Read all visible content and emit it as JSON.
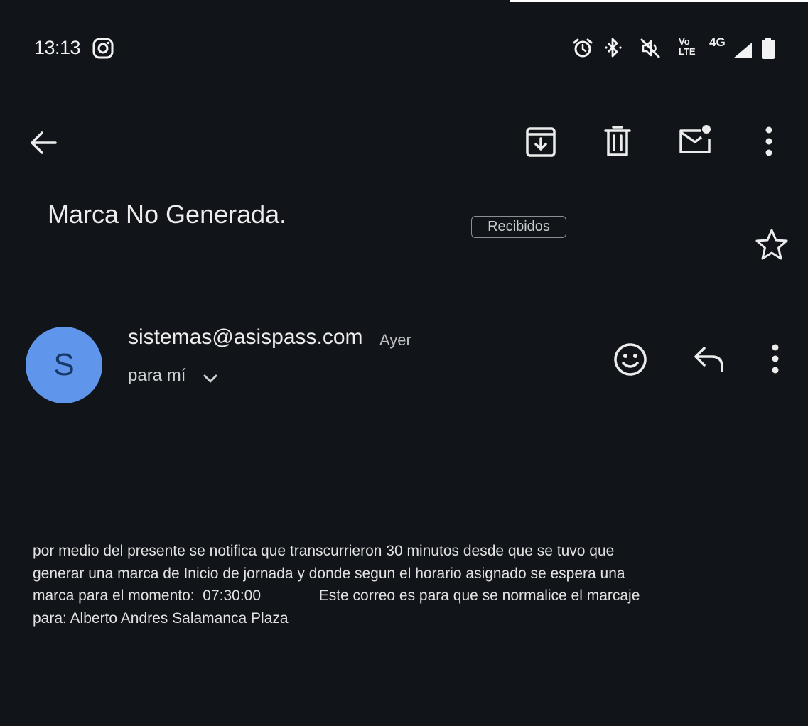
{
  "status_bar": {
    "time": "13:13",
    "network": "4G",
    "volte_top": "Vo",
    "volte_bottom": "LTE",
    "icons": [
      "instagram-icon",
      "alarm-icon",
      "bluetooth-icon",
      "mute-icon",
      "volte-icon",
      "signal-icon",
      "battery-icon"
    ]
  },
  "toolbar": {
    "icons": [
      "back-arrow-icon",
      "archive-icon",
      "delete-icon",
      "mark-unread-icon",
      "more-vert-icon"
    ]
  },
  "email": {
    "subject": "Marca No Generada.",
    "label": "Recibidos",
    "sender": {
      "initial": "S",
      "address": "sistemas@asispass.com",
      "date": "Ayer",
      "recipient": "para mí",
      "avatar_color": "#5f95eb"
    },
    "body_lines": [
      "por medio del presente se notifica que transcurrieron 30 minutos desde que se tuvo que",
      "generar una marca de Inicio de jornada y donde segun el horario asignado se espera una",
      "marca para el momento:  07:30:00              Este correo es para que se normalice el marcaje",
      "para: Alberto Andres Salamanca Plaza"
    ]
  },
  "colors": {
    "background": "#111418",
    "text": "#e6e6e6",
    "accent": "#5f95eb"
  }
}
